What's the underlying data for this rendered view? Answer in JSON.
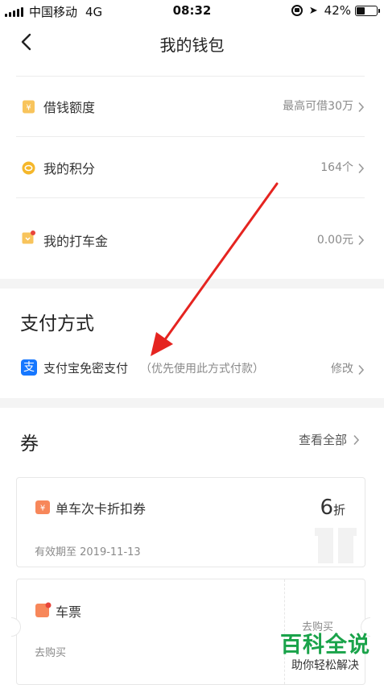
{
  "status_bar": {
    "carrier": "中国移动",
    "network": "4G",
    "time": "08:32",
    "battery_text": "42%",
    "battery_level": 0.42
  },
  "nav": {
    "title": "我的钱包"
  },
  "rows": [
    {
      "label": "借钱额度",
      "value": "最高可借30万",
      "icon": "loan-quota-icon"
    },
    {
      "label": "我的积分",
      "value": "164个",
      "icon": "points-coin-icon"
    },
    {
      "label": "我的打车金",
      "value": "0.00元",
      "icon": "ride-money-icon"
    }
  ],
  "payment": {
    "title": "支付方式",
    "method_label": "支付宝免密支付",
    "method_hint": "（优先使用此方式付款）",
    "edit_label": "修改",
    "icon_char": "支"
  },
  "coupons": {
    "title": "券",
    "view_all": "查看全部",
    "items": [
      {
        "title": "单车次卡折扣券",
        "subtitle": "有效期至 2019-11-13",
        "discount_num": "6",
        "discount_unit": "折"
      },
      {
        "title": "车票",
        "subtitle": "去购买",
        "right_label": "去购买"
      }
    ]
  },
  "watermark": {
    "main": "百科全说",
    "sub": "助你轻松解决"
  },
  "colors": {
    "accent_orange": "#f5a623",
    "alipay_blue": "#1677ff",
    "arrow_red": "#e52420",
    "watermark_green": "#1aa34a",
    "coupon_orange": "#f7875a"
  }
}
